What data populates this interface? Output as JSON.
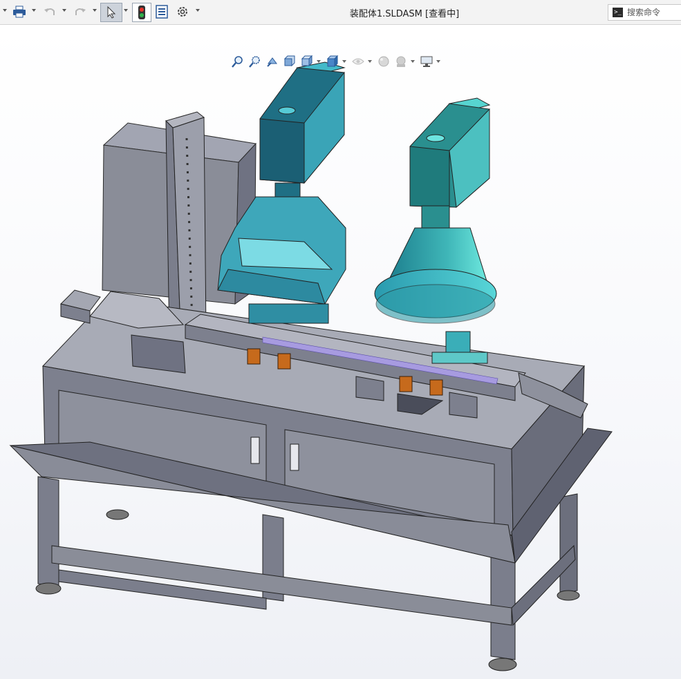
{
  "window": {
    "title": "装配体1.SLDASM [查看中]"
  },
  "toolbar": {
    "items": [
      "print-icon",
      "undo-icon",
      "redo-icon",
      "select-icon",
      "rebuild-icon",
      "file-properties-icon",
      "options-icon"
    ]
  },
  "search": {
    "placeholder": "搜索命令",
    "value": ""
  },
  "view_toolbar": {
    "items": [
      "zoom-to-fit-icon",
      "zoom-to-area-icon",
      "previous-view-icon",
      "section-view-icon",
      "view-orientation-icon",
      "display-style-icon",
      "hide-show-items-icon",
      "edit-appearance-icon",
      "apply-scene-icon",
      "view-settings-icon"
    ]
  },
  "colors": {
    "model_grey": "#8a8d98",
    "model_dark": "#5e6170",
    "cylinder_teal": "#3fb6c4",
    "cylinder_dark": "#1d6f84",
    "accent_orange": "#c66a1c",
    "rail_purple": "#a79be0"
  }
}
